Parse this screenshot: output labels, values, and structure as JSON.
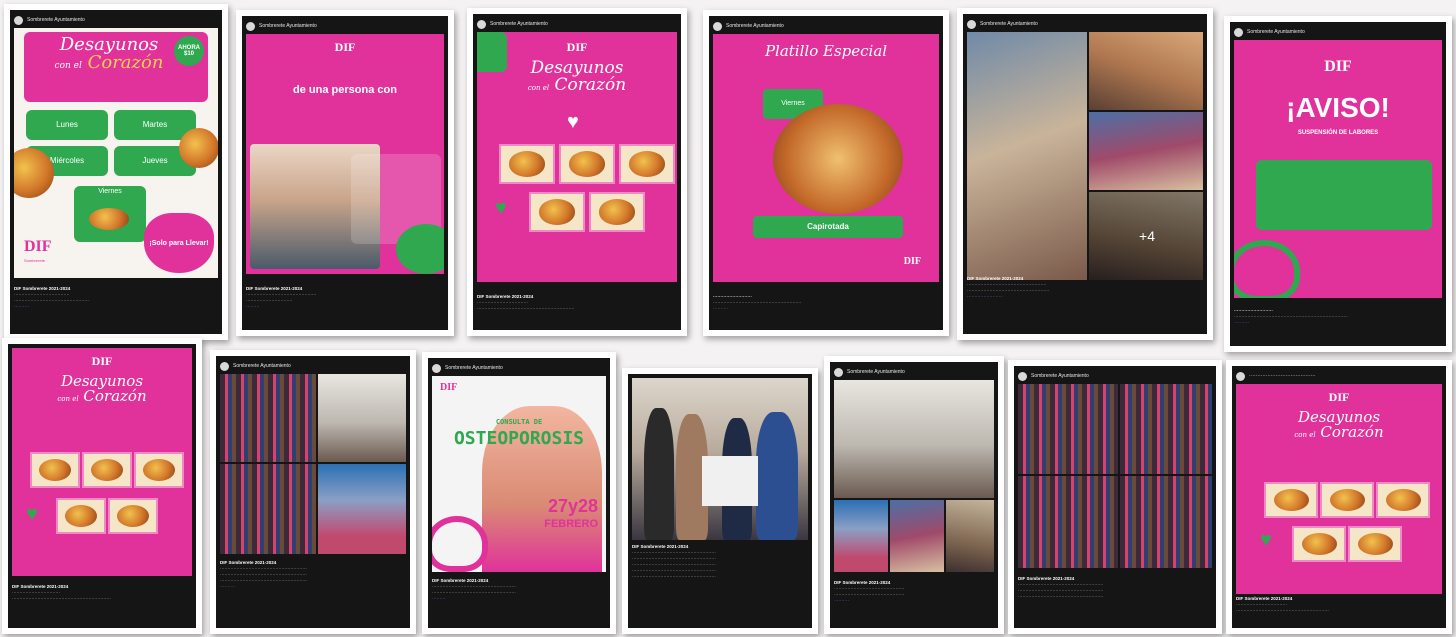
{
  "page_name": "Sombrerete Ayuntamiento",
  "footer_name": "DIF Sombrerete 2021-2024",
  "posts": [
    {
      "flyer_title_1": "Desayunos",
      "flyer_title_2": "con el",
      "flyer_title_3": "Corazón",
      "badge": "AHORA $10",
      "days": [
        "Lunes",
        "Martes",
        "Miércoles",
        "Jueves",
        "Viernes"
      ],
      "tagline": "¡Solo para Llevar!",
      "logo": "DIF",
      "logo_sub": "Sombrerete"
    },
    {
      "logo": "DIF",
      "headline": "de una persona con"
    },
    {
      "logo": "DIF",
      "flyer_title_1": "Desayunos",
      "flyer_title_2": "con el",
      "flyer_title_3": "Corazón"
    },
    {
      "flyer_title": "Platillo Especial",
      "day": "Viernes",
      "dish": "Capirotada",
      "logo": "DIF"
    },
    {
      "kind": "photos"
    },
    {
      "logo": "DIF",
      "title": "¡AVISO!",
      "subtitle": "SUSPENSIÓN DE LABORES"
    },
    {
      "logo": "DIF",
      "flyer_title_1": "Desayunos",
      "flyer_title_2": "con el",
      "flyer_title_3": "Corazón"
    },
    {
      "kind": "photos"
    },
    {
      "logo": "DIF",
      "title_1": "CONSULTA DE",
      "title_2": "OSTEOPOROSIS",
      "date_1": "27y28",
      "date_2": "FEBRERO"
    },
    {
      "kind": "photos"
    },
    {
      "kind": "photos"
    },
    {
      "kind": "photos"
    },
    {
      "logo": "DIF",
      "flyer_title_1": "Desayunos",
      "flyer_title_2": "con el",
      "flyer_title_3": "Corazón"
    }
  ],
  "colors": {
    "pink": "#e0329a",
    "green": "#2fa84f",
    "dark": "#151515"
  }
}
